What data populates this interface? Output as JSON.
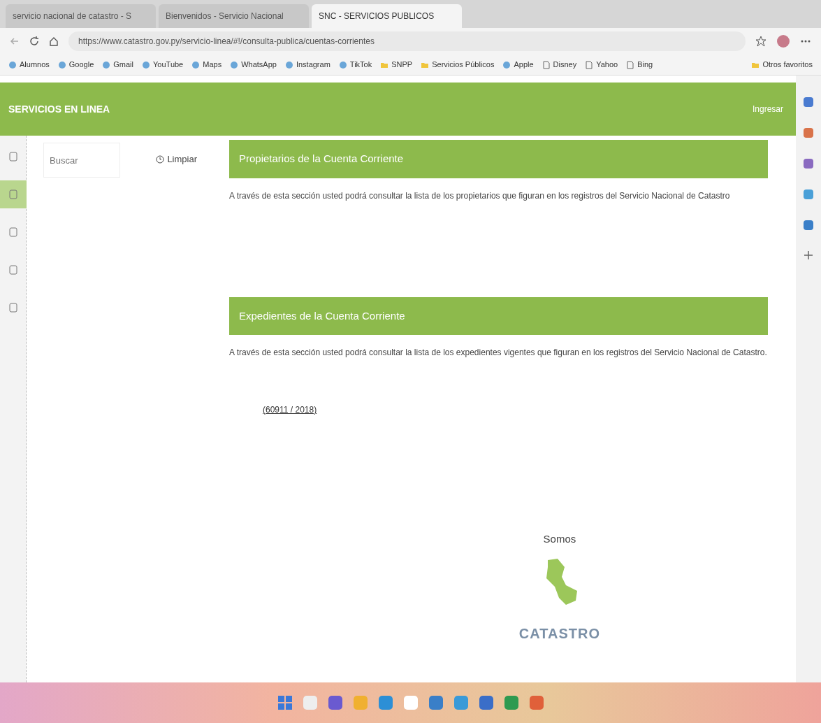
{
  "browser": {
    "tabs": [
      {
        "title": "servicio nacional de catastro - S",
        "selected": false
      },
      {
        "title": "Bienvenidos - Servicio Nacional",
        "selected": false
      },
      {
        "title": "SNC - SERVICIOS PUBLICOS",
        "selected": true
      }
    ],
    "address": "https://www.catastro.gov.py/servicio-linea/#!/consulta-publica/cuentas-corrientes",
    "bookmarks": [
      {
        "label": "Alumnos",
        "kind": "site"
      },
      {
        "label": "Google",
        "kind": "site"
      },
      {
        "label": "Gmail",
        "kind": "site"
      },
      {
        "label": "YouTube",
        "kind": "site"
      },
      {
        "label": "Maps",
        "kind": "site"
      },
      {
        "label": "WhatsApp",
        "kind": "site"
      },
      {
        "label": "Instagram",
        "kind": "site"
      },
      {
        "label": "TikTok",
        "kind": "site"
      },
      {
        "label": "SNPP",
        "kind": "folder"
      },
      {
        "label": "Servicios Públicos",
        "kind": "folder"
      },
      {
        "label": "Apple",
        "kind": "site"
      },
      {
        "label": "Disney",
        "kind": "page"
      },
      {
        "label": "Yahoo",
        "kind": "page"
      },
      {
        "label": "Bing",
        "kind": "page"
      }
    ],
    "other_bookmarks": "Otros favoritos"
  },
  "app": {
    "brand": "SERVICIOS EN LINEA",
    "login": "Ingresar",
    "rail": [
      {
        "selected": false
      },
      {
        "selected": true
      },
      {
        "selected": false
      },
      {
        "selected": false
      },
      {
        "selected": false
      }
    ],
    "search": {
      "placeholder": "Buscar"
    },
    "clear": "Limpiar",
    "sections": [
      {
        "title": "Propietarios de la Cuenta Corriente",
        "description": "A través de esta sección usted podrá consultar la lista de los propietarios que figuran en los registros del Servicio Nacional de Catastro"
      },
      {
        "title": "Expedientes de la Cuenta Corriente",
        "description": "A través de esta sección usted podrá consultar la lista de los expedientes vigentes que figuran en los registros del Servicio Nacional de Catastro.",
        "link": "(60911 / 2018)"
      }
    ],
    "footer": {
      "heading": "Somos",
      "logo": "CATASTRO"
    }
  }
}
